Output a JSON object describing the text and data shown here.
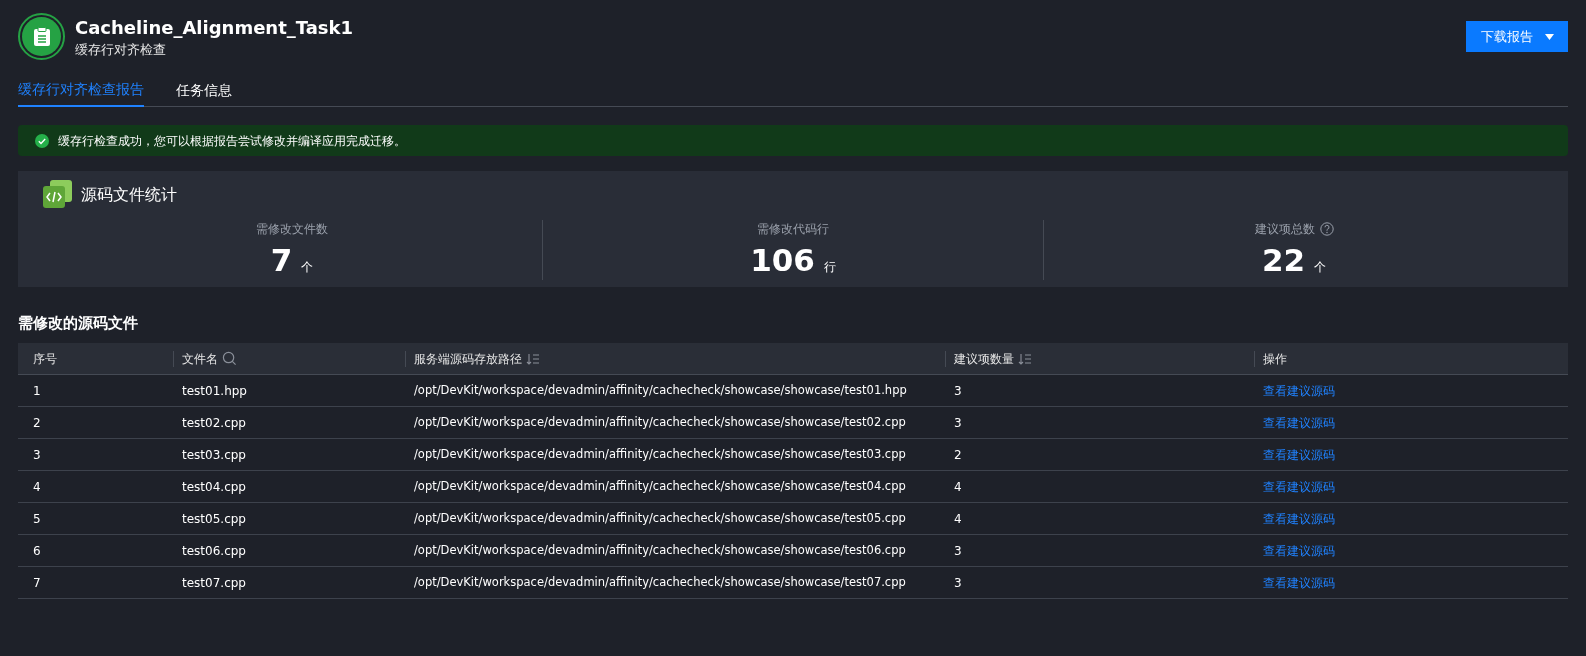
{
  "header": {
    "title": "Cacheline_Alignment_Task1",
    "subtitle": "缓存行对齐检查",
    "download_button": "下载报告"
  },
  "tabs": [
    {
      "label": "缓存行对齐检查报告",
      "selected": true
    },
    {
      "label": "任务信息",
      "selected": false
    }
  ],
  "alert": {
    "message": "缓存行检查成功，您可以根据报告尝试修改并编译应用完成迁移。"
  },
  "stats": {
    "title": "源码文件统计",
    "items": [
      {
        "label": "需修改文件数",
        "value": "7",
        "unit": "个",
        "help": false
      },
      {
        "label": "需修改代码行",
        "value": "106",
        "unit": "行",
        "help": false
      },
      {
        "label": "建议项总数",
        "value": "22",
        "unit": "个",
        "help": true
      }
    ]
  },
  "table": {
    "title": "需修改的源码文件",
    "columns": [
      {
        "label": "序号",
        "kind": "plain"
      },
      {
        "label": "文件名",
        "kind": "search"
      },
      {
        "label": "服务端源码存放路径",
        "kind": "sort"
      },
      {
        "label": "建议项数量",
        "kind": "sort"
      },
      {
        "label": "操作",
        "kind": "plain"
      }
    ],
    "rows": [
      {
        "index": "1",
        "file": "test01.hpp",
        "path": "/opt/DevKit/workspace/devadmin/affinity/cachecheck/showcase/showcase/test01.hpp",
        "count": "3",
        "action": "查看建议源码"
      },
      {
        "index": "2",
        "file": "test02.cpp",
        "path": "/opt/DevKit/workspace/devadmin/affinity/cachecheck/showcase/showcase/test02.cpp",
        "count": "3",
        "action": "查看建议源码"
      },
      {
        "index": "3",
        "file": "test03.cpp",
        "path": "/opt/DevKit/workspace/devadmin/affinity/cachecheck/showcase/showcase/test03.cpp",
        "count": "2",
        "action": "查看建议源码"
      },
      {
        "index": "4",
        "file": "test04.cpp",
        "path": "/opt/DevKit/workspace/devadmin/affinity/cachecheck/showcase/showcase/test04.cpp",
        "count": "4",
        "action": "查看建议源码"
      },
      {
        "index": "5",
        "file": "test05.cpp",
        "path": "/opt/DevKit/workspace/devadmin/affinity/cachecheck/showcase/showcase/test05.cpp",
        "count": "4",
        "action": "查看建议源码"
      },
      {
        "index": "6",
        "file": "test06.cpp",
        "path": "/opt/DevKit/workspace/devadmin/affinity/cachecheck/showcase/showcase/test06.cpp",
        "count": "3",
        "action": "查看建议源码"
      },
      {
        "index": "7",
        "file": "test07.cpp",
        "path": "/opt/DevKit/workspace/devadmin/affinity/cachecheck/showcase/showcase/test07.cpp",
        "count": "3",
        "action": "查看建议源码"
      }
    ]
  }
}
